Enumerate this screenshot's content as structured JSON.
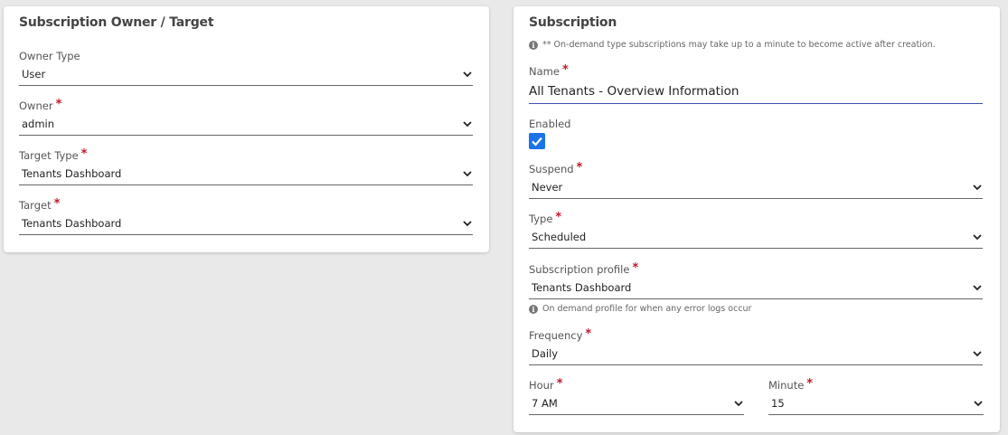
{
  "left_card": {
    "title": "Subscription Owner / Target",
    "owner_type": {
      "label": "Owner Type",
      "value": "User"
    },
    "owner": {
      "label": "Owner",
      "value": "admin"
    },
    "target_type": {
      "label": "Target Type",
      "value": "Tenants Dashboard"
    },
    "target": {
      "label": "Target",
      "value": "Tenants Dashboard"
    }
  },
  "right_card": {
    "title": "Subscription",
    "info_note": "** On-demand type subscriptions may take up to a minute to become active after creation.",
    "name": {
      "label": "Name",
      "value": "All Tenants - Overview Information"
    },
    "enabled": {
      "label": "Enabled",
      "checked": true
    },
    "suspend": {
      "label": "Suspend",
      "value": "Never"
    },
    "type": {
      "label": "Type",
      "value": "Scheduled"
    },
    "profile": {
      "label": "Subscription profile",
      "value": "Tenants Dashboard",
      "hint": "On demand profile for when any error logs occur"
    },
    "frequency": {
      "label": "Frequency",
      "value": "Daily"
    },
    "hour": {
      "label": "Hour",
      "value": "7 AM"
    },
    "minute": {
      "label": "Minute",
      "value": "15"
    }
  },
  "required_marker": "*",
  "info_icon_glyph": "i",
  "colors": {
    "required": "#c0192a",
    "accent": "#1a73e8",
    "focus_underline": "#3f51b5"
  }
}
